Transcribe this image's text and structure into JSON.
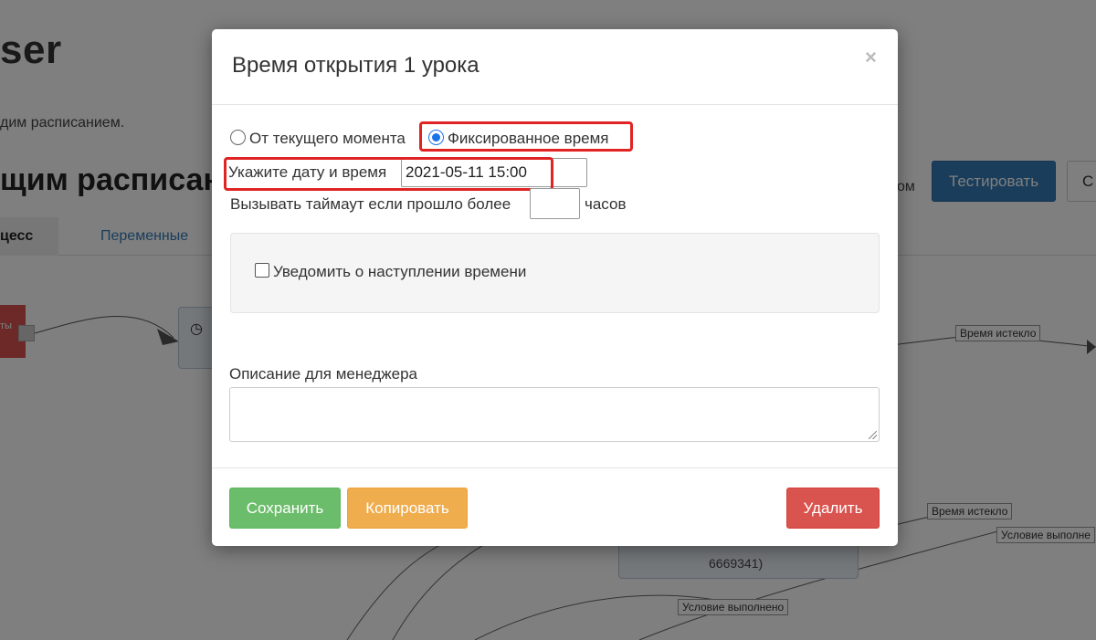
{
  "background": {
    "title_fragment": "ser",
    "subtitle_fragment": "дим расписанием.",
    "heading_fragment": "щим расписан",
    "tabs": [
      {
        "label": "цесс"
      },
      {
        "label": "Переменные"
      }
    ],
    "text_fragment": "ом",
    "test_button": "Тестировать",
    "other_button": "С",
    "red_node_text": "ты",
    "node_text": "6669341)",
    "canvas_labels": {
      "time_expired_1": "Время истекло",
      "time_expired_2": "Время истекло",
      "condition_met_1": "Условие выполне",
      "condition_met_2": "Условие выполнено"
    },
    "clock_icon": "clock-icon"
  },
  "modal": {
    "title": "Время открытия 1 урока",
    "close_symbol": "×",
    "radio_options": [
      {
        "label": "От текущего момента",
        "checked": false
      },
      {
        "label": "Фиксированное время",
        "checked": true
      }
    ],
    "datetime_label": "Укажите дату и время",
    "datetime_value": "2021-05-11 15:00",
    "timeout_label": "Вызывать таймаут если прошло более",
    "timeout_value": "",
    "timeout_unit": "часов",
    "notify_label": "Уведомить о наступлении времени",
    "notify_checked": false,
    "description_label": "Описание для менеджера",
    "description_value": "",
    "buttons": {
      "save": "Сохранить",
      "copy": "Копировать",
      "delete": "Удалить"
    }
  },
  "colors": {
    "highlight": "#e02424",
    "primary": "#337ab7",
    "success": "#6bbd6b",
    "warning": "#f0ad4e",
    "danger": "#d9534f",
    "radio_accent": "#1a73e8"
  }
}
